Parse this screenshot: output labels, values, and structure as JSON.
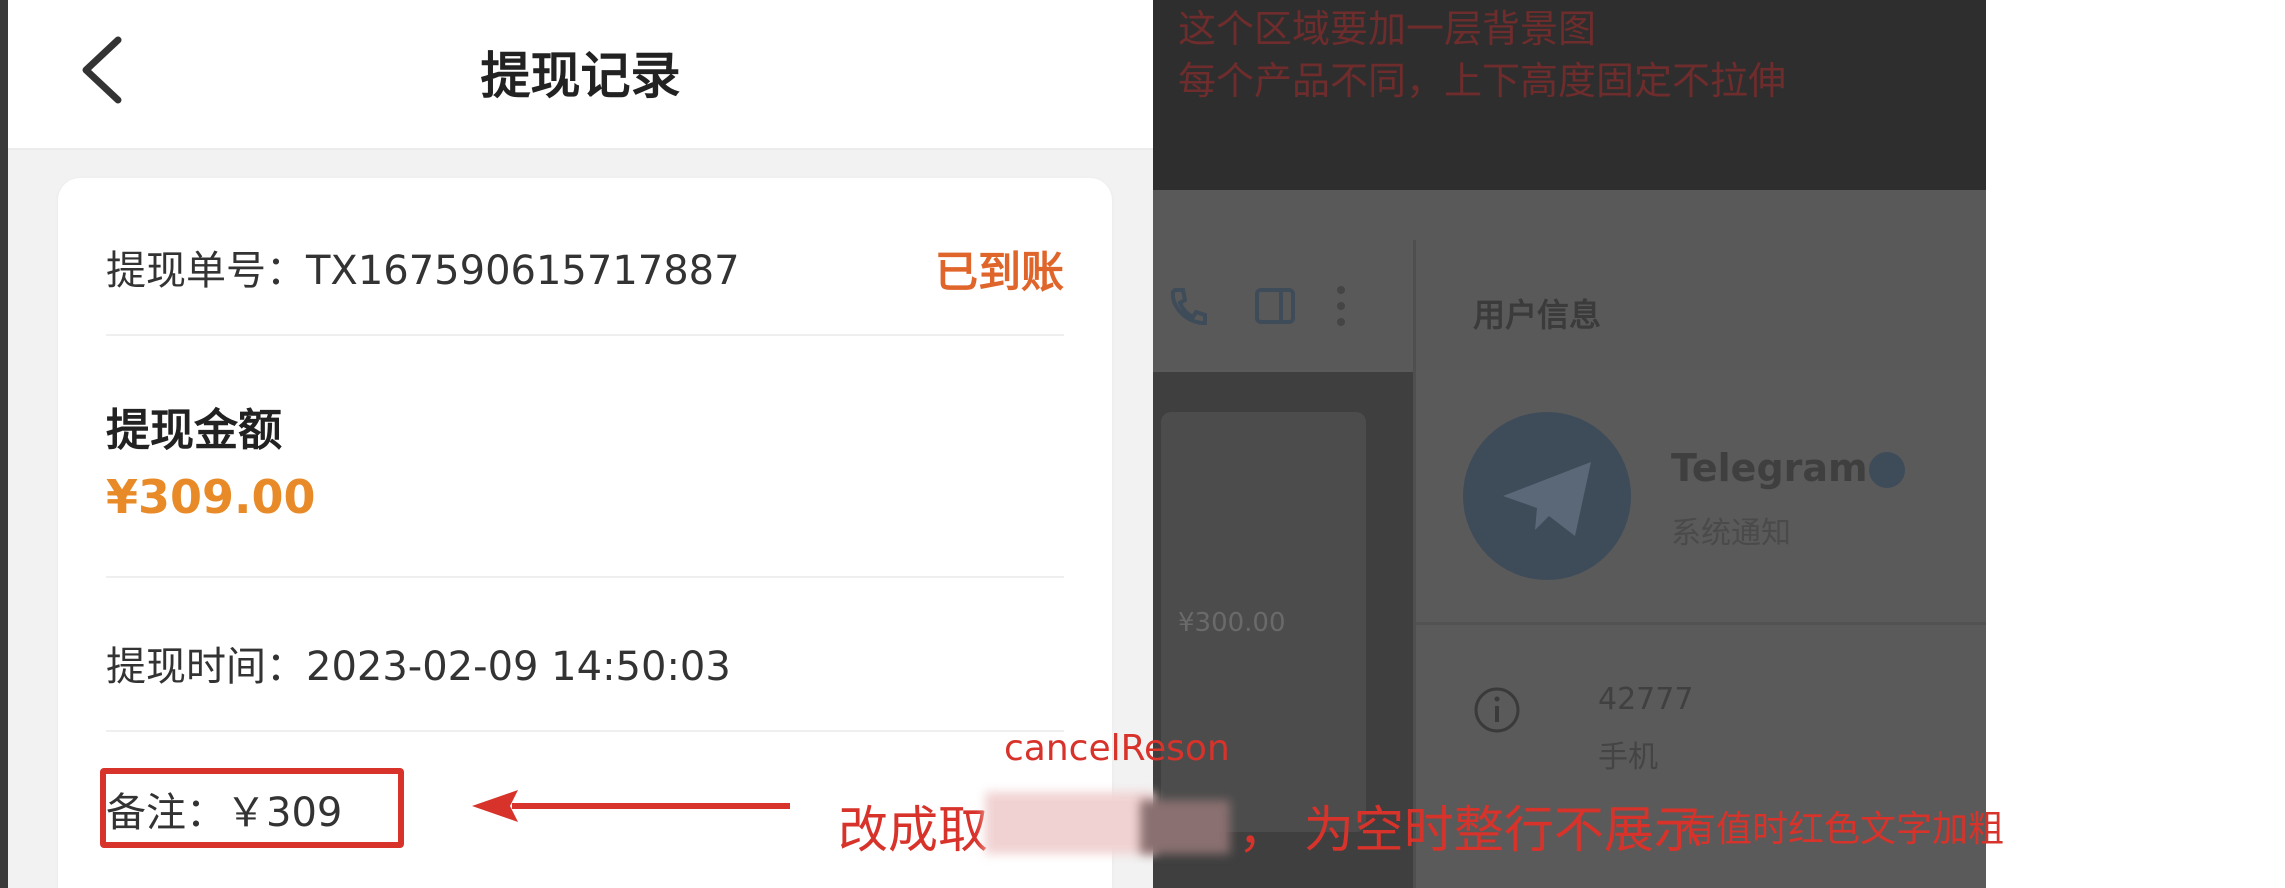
{
  "header": {
    "title": "提现记录"
  },
  "record": {
    "order_label": "提现单号：",
    "order_no": "TX167590615717887",
    "status": "已到账",
    "amount_label": "提现金额",
    "amount": "¥309.00",
    "time_label": "提现时间：",
    "time": "2023-02-09 14:50:03",
    "note_label": "备注：",
    "note_value": "￥309"
  },
  "background_screen": {
    "user_info_title": "用户信息",
    "contact_name": "Telegram",
    "contact_subtitle": "系统通知",
    "info_value": "42777",
    "info_label": "手机",
    "card_amount": "¥300.00"
  },
  "annotations": {
    "field_name": "cancelReson",
    "main_text": "改成取",
    "sub_text": "， 为空时整行不展示",
    "detail_text": "有值时红色文字加粗",
    "top_line1": "这个区域要加一层背景图",
    "top_line2": "每个产品不同，上下高度固定不拉伸"
  },
  "colors": {
    "status": "#e0652b",
    "amount": "#e88a27",
    "annotation_red": "#d7332b"
  }
}
